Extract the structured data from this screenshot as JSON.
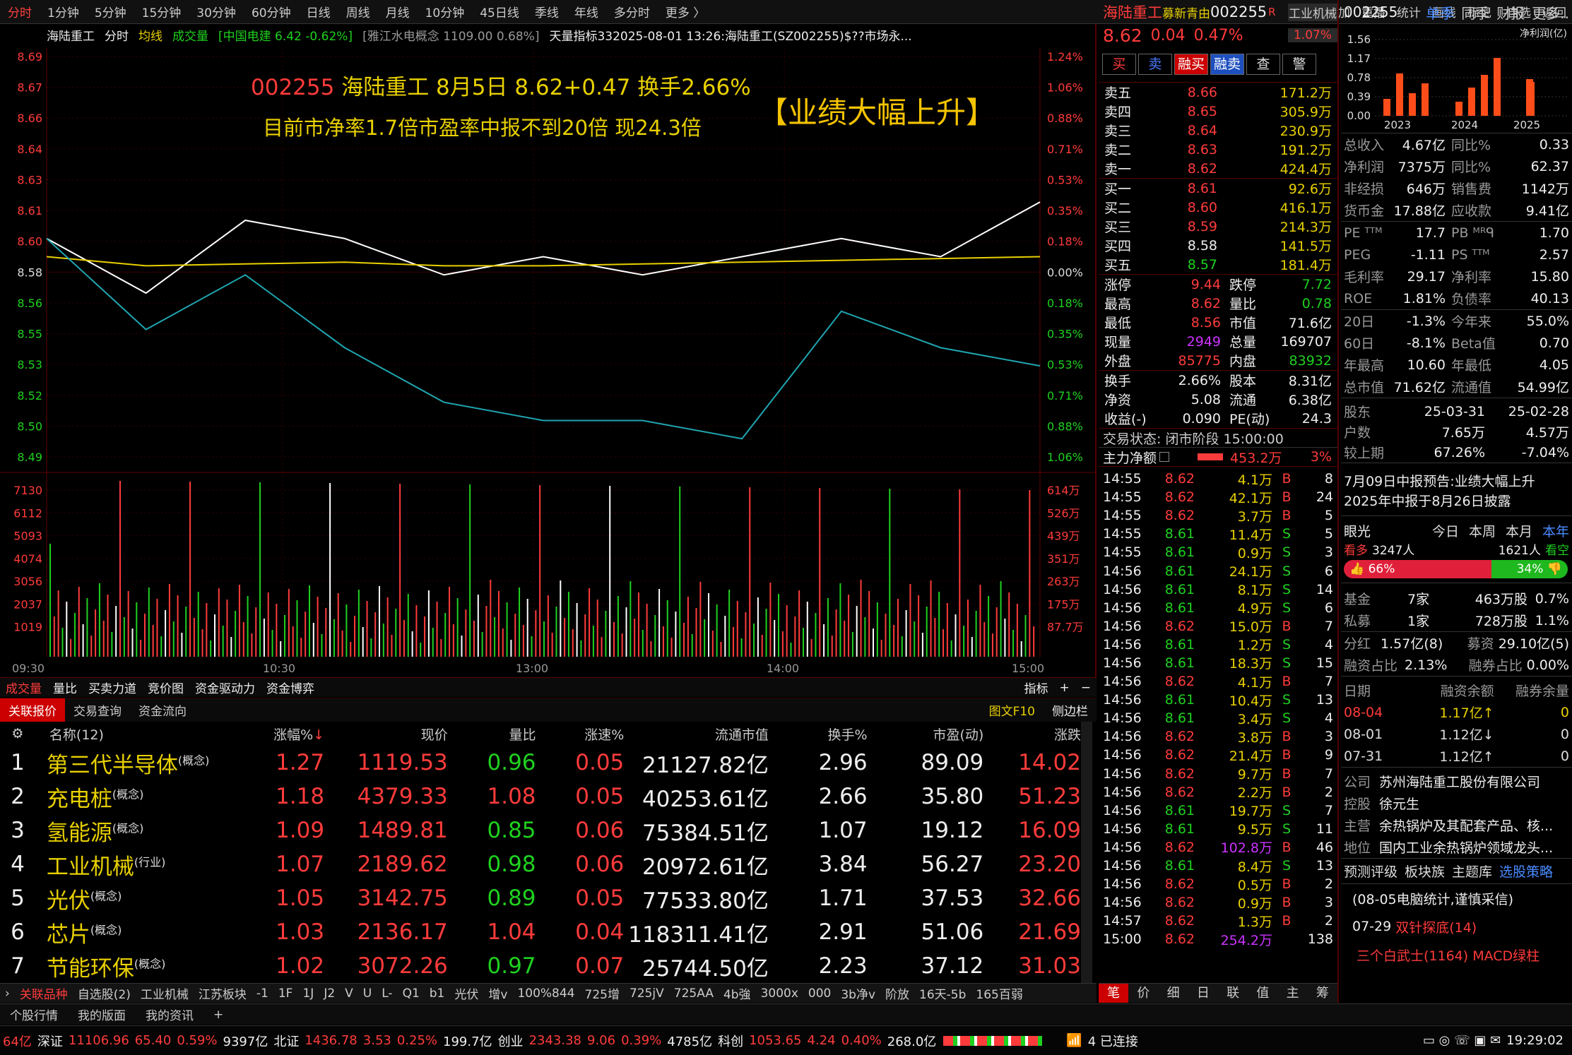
{
  "topbar": {
    "periods": [
      "分时",
      "1分钟",
      "5分钟",
      "15分钟",
      "30分钟",
      "60分钟",
      "日线",
      "周线",
      "月线",
      "10分钟",
      "45日线",
      "季线",
      "年线",
      "多分时",
      "更多 〉"
    ],
    "tools": [
      "竞价",
      "叠加",
      "重播",
      "统计",
      "画线",
      "标记",
      "-自选",
      "返回"
    ]
  },
  "chart": {
    "header": {
      "name": "海陆重工",
      "mode": "分时",
      "avg": "均线",
      "vol": "成交量",
      "ref1": "[中国电建 6.42 -0.62%]",
      "ref2": "[雅江水电概念 1109.00 0.68%]",
      "ref3": "天量指标332025-08-01 13:26:海陆重工(SZ002255)$??市场永..."
    },
    "annotation": {
      "code": "002255",
      "line1": "海陆重工 8月5日 8.62+0.47 换手2.66%",
      "line2": "目前市净率1.7倍市盈率中报不到20倍 现24.3倍",
      "badge": "【业绩大幅上升】"
    },
    "price_axis": [
      "8.69",
      "8.67",
      "8.66",
      "8.64",
      "8.63",
      "8.61",
      "8.60",
      "8.58",
      "8.56",
      "8.55",
      "8.53",
      "8.52",
      "8.50",
      "8.49"
    ],
    "pct_axis": [
      "1.24%",
      "1.06%",
      "0.88%",
      "0.71%",
      "0.53%",
      "0.35%",
      "0.18%",
      "0.00%",
      "0.18%",
      "0.35%",
      "0.53%",
      "0.71%",
      "0.88%",
      "1.06%"
    ],
    "vol_axis_left": [
      "7130",
      "6112",
      "5093",
      "4074",
      "3056",
      "2037",
      "1019"
    ],
    "vol_axis_right": [
      "614万",
      "526万",
      "439万",
      "351万",
      "263万",
      "175万",
      "87.7万"
    ],
    "time_axis": [
      "09:30",
      "10:30",
      "13:00",
      "14:00",
      "15:00"
    ],
    "colors": {
      "price_line": "#ffffff",
      "avg_line": "#e8d000",
      "ref_line": "#1fa5b0",
      "up": "#ff3b3b",
      "down": "#1fd11f"
    }
  },
  "chart_data": {
    "type": "line",
    "title": "002255 海陆重工 8月5日 8.62+0.47 换手2.66%",
    "x": [
      "09:30",
      "10:30",
      "13:00",
      "14:00",
      "15:00"
    ],
    "ylim": [
      8.48,
      8.7
    ],
    "series": [
      {
        "name": "海陆重工",
        "values": [
          8.6,
          8.57,
          8.61,
          8.6,
          8.58,
          8.59,
          8.58,
          8.59,
          8.6,
          8.59,
          8.62
        ]
      },
      {
        "name": "均线",
        "values": [
          8.59,
          8.585,
          8.586,
          8.587,
          8.585,
          8.585,
          8.586,
          8.587,
          8.588,
          8.589,
          8.59
        ]
      },
      {
        "name": "中国电建",
        "values": [
          8.6,
          8.55,
          8.58,
          8.54,
          8.51,
          8.5,
          8.5,
          8.49,
          8.56,
          8.54,
          8.53
        ]
      }
    ]
  },
  "indicator_tabs": [
    "成交量",
    "量比",
    "买卖力道",
    "竞价图",
    "资金驱动力",
    "资金博弈"
  ],
  "indicator_right": [
    "指标",
    "+",
    "−"
  ],
  "sub_tabs": [
    "关联报价",
    "交易查询",
    "资金流向"
  ],
  "sub_tabs_right": [
    "图文F10",
    "侧边栏"
  ],
  "sector_table": {
    "headers": [
      "名称(12)",
      "涨幅%",
      "现价",
      "量比",
      "涨速%",
      "流通市值",
      "换手%",
      "市盈(动)",
      "涨跌"
    ],
    "rows": [
      {
        "idx": "1",
        "name": "第三代半导体",
        "tag": "(概念)",
        "chg": "1.27",
        "price": "1119.53",
        "vr": "0.96",
        "speed": "0.05",
        "cap": "21127.82亿",
        "turn": "2.96",
        "pe": "89.09",
        "diff": "14.02"
      },
      {
        "idx": "2",
        "name": "充电桩",
        "tag": "(概念)",
        "chg": "1.18",
        "price": "4379.33",
        "vr": "1.08",
        "speed": "0.05",
        "cap": "40253.61亿",
        "turn": "2.66",
        "pe": "35.80",
        "diff": "51.23"
      },
      {
        "idx": "3",
        "name": "氢能源",
        "tag": "(概念)",
        "chg": "1.09",
        "price": "1489.81",
        "vr": "0.85",
        "speed": "0.06",
        "cap": "75384.51亿",
        "turn": "1.07",
        "pe": "19.12",
        "diff": "16.09"
      },
      {
        "idx": "4",
        "name": "工业机械",
        "tag": "(行业)",
        "chg": "1.07",
        "price": "2189.62",
        "vr": "0.98",
        "speed": "0.06",
        "cap": "20972.61亿",
        "turn": "3.84",
        "pe": "56.27",
        "diff": "23.20"
      },
      {
        "idx": "5",
        "name": "光伏",
        "tag": "(概念)",
        "chg": "1.05",
        "price": "3142.75",
        "vr": "0.89",
        "speed": "0.05",
        "cap": "77533.80亿",
        "turn": "1.71",
        "pe": "37.53",
        "diff": "32.66"
      },
      {
        "idx": "6",
        "name": "芯片",
        "tag": "(概念)",
        "chg": "1.03",
        "price": "2136.17",
        "vr": "1.04",
        "speed": "0.04",
        "cap": "118311.41亿",
        "turn": "2.91",
        "pe": "51.06",
        "diff": "21.69"
      },
      {
        "idx": "7",
        "name": "节能环保",
        "tag": "(概念)",
        "chg": "1.02",
        "price": "3072.26",
        "vr": "0.97",
        "speed": "0.07",
        "cap": "25744.50亿",
        "turn": "2.23",
        "pe": "37.12",
        "diff": "31.03"
      }
    ]
  },
  "bottom_tabs": [
    "关联品种",
    "自选股(2)",
    "工业机械",
    "江苏板块",
    "-1",
    "1F",
    "1J",
    "J2",
    "V",
    "U",
    "L-",
    "Q1",
    "b1",
    "光伏",
    "增v",
    "100%844",
    "725增",
    "725jV",
    "725AA",
    "4b強",
    "3000x",
    "000",
    "3b净v",
    "阶放",
    "16天-5b",
    "165百弱"
  ],
  "bottom_tabs2": [
    "个股行情",
    "我的版面",
    "我的资讯",
    "+"
  ],
  "status": {
    "sz_vol": "64亿",
    "sz": "深证",
    "sz_val": "11106.96",
    "sz_chg": "65.40",
    "sz_pct": "0.59%",
    "sz_amt": "9397亿",
    "bz": "北证",
    "bz_val": "1436.78",
    "bz_chg": "3.53",
    "bz_pct": "0.25%",
    "bz_amt": "199.7亿",
    "cy": "创业",
    "cy_val": "2343.38",
    "cy_chg": "9.06",
    "cy_pct": "0.39%",
    "cy_amt": "4785亿",
    "kc": "科创",
    "kc_val": "1053.65",
    "kc_chg": "4.24",
    "kc_pct": "0.40%",
    "kc_amt": "268.0亿",
    "conn": "4 已连接",
    "time": "19:29:02"
  },
  "quote": {
    "name": "海陆重工",
    "tag": "募新青由",
    "code": "002255",
    "flag": "R",
    "industry": "工业机械",
    "industry_pct": "1.07%",
    "price": "8.62",
    "change": "0.04",
    "pct": "0.47%",
    "buttons": [
      "买",
      "卖",
      "融买",
      "融卖",
      "查",
      "警"
    ],
    "asks": [
      {
        "label": "卖五",
        "price": "8.66",
        "vol": "171.2万"
      },
      {
        "label": "卖四",
        "price": "8.65",
        "vol": "305.9万"
      },
      {
        "label": "卖三",
        "price": "8.64",
        "vol": "230.9万"
      },
      {
        "label": "卖二",
        "price": "8.63",
        "vol": "191.2万"
      },
      {
        "label": "卖一",
        "price": "8.62",
        "vol": "424.4万"
      }
    ],
    "bids": [
      {
        "label": "买一",
        "price": "8.61",
        "vol": "92.6万"
      },
      {
        "label": "买二",
        "price": "8.60",
        "vol": "416.1万"
      },
      {
        "label": "买三",
        "price": "8.59",
        "vol": "214.3万"
      },
      {
        "label": "买四",
        "price": "8.58",
        "vol": "141.5万"
      },
      {
        "label": "买五",
        "price": "8.57",
        "vol": "181.4万"
      }
    ],
    "stats": [
      {
        "l1": "涨停",
        "v1": "9.44",
        "l2": "跌停",
        "v2": "7.72"
      },
      {
        "l1": "最高",
        "v1": "8.62",
        "l2": "量比",
        "v2": "0.78"
      },
      {
        "l1": "最低",
        "v1": "8.56",
        "l2": "市值",
        "v2": "71.6亿"
      },
      {
        "l1": "现量",
        "v1": "2949",
        "l2": "总量",
        "v2": "169707"
      },
      {
        "l1": "外盘",
        "v1": "85775",
        "l2": "内盘",
        "v2": "83932"
      }
    ],
    "stats2": [
      {
        "l1": "换手",
        "v1": "2.66%",
        "l2": "股本",
        "v2": "8.31亿"
      },
      {
        "l1": "净资",
        "v1": "5.08",
        "l2": "流通",
        "v2": "6.38亿"
      },
      {
        "l1": "收益(-)",
        "v1": "0.090",
        "l2": "PE(动)",
        "v2": "24.3"
      }
    ],
    "trade_state": "交易状态: 闭市阶段 15:00:00",
    "main_net_label": "主力净额",
    "main_net_val": "453.2万",
    "main_net_pct": "3%",
    "ticks": [
      {
        "t": "14:55",
        "p": "8.62",
        "v": "4.1万",
        "d": "B",
        "n": "8"
      },
      {
        "t": "14:55",
        "p": "8.62",
        "v": "42.1万",
        "d": "B",
        "n": "24"
      },
      {
        "t": "14:55",
        "p": "8.62",
        "v": "3.7万",
        "d": "B",
        "n": "5"
      },
      {
        "t": "14:55",
        "p": "8.61",
        "v": "11.4万",
        "d": "S",
        "n": "5"
      },
      {
        "t": "14:55",
        "p": "8.61",
        "v": "0.9万",
        "d": "S",
        "n": "3"
      },
      {
        "t": "14:56",
        "p": "8.61",
        "v": "24.1万",
        "d": "S",
        "n": "6"
      },
      {
        "t": "14:56",
        "p": "8.61",
        "v": "8.1万",
        "d": "S",
        "n": "14"
      },
      {
        "t": "14:56",
        "p": "8.61",
        "v": "4.9万",
        "d": "S",
        "n": "6"
      },
      {
        "t": "14:56",
        "p": "8.62",
        "v": "15.0万",
        "d": "B",
        "n": "7"
      },
      {
        "t": "14:56",
        "p": "8.61",
        "v": "1.2万",
        "d": "S",
        "n": "4"
      },
      {
        "t": "14:56",
        "p": "8.61",
        "v": "18.3万",
        "d": "S",
        "n": "15"
      },
      {
        "t": "14:56",
        "p": "8.62",
        "v": "4.1万",
        "d": "B",
        "n": "7"
      },
      {
        "t": "14:56",
        "p": "8.61",
        "v": "10.4万",
        "d": "S",
        "n": "13"
      },
      {
        "t": "14:56",
        "p": "8.61",
        "v": "3.4万",
        "d": "S",
        "n": "4"
      },
      {
        "t": "14:56",
        "p": "8.62",
        "v": "3.8万",
        "d": "B",
        "n": "3"
      },
      {
        "t": "14:56",
        "p": "8.62",
        "v": "21.4万",
        "d": "B",
        "n": "9"
      },
      {
        "t": "14:56",
        "p": "8.62",
        "v": "9.7万",
        "d": "B",
        "n": "7"
      },
      {
        "t": "14:56",
        "p": "8.62",
        "v": "2.2万",
        "d": "B",
        "n": "2"
      },
      {
        "t": "14:56",
        "p": "8.61",
        "v": "19.7万",
        "d": "S",
        "n": "7"
      },
      {
        "t": "14:56",
        "p": "8.61",
        "v": "9.5万",
        "d": "S",
        "n": "11"
      },
      {
        "t": "14:56",
        "p": "8.62",
        "v": "102.8万",
        "d": "B",
        "n": "46"
      },
      {
        "t": "14:56",
        "p": "8.61",
        "v": "8.4万",
        "d": "S",
        "n": "13"
      },
      {
        "t": "14:56",
        "p": "8.62",
        "v": "0.5万",
        "d": "B",
        "n": "2"
      },
      {
        "t": "14:56",
        "p": "8.62",
        "v": "0.9万",
        "d": "B",
        "n": "3"
      },
      {
        "t": "14:57",
        "p": "8.62",
        "v": "1.3万",
        "d": "B",
        "n": "2"
      },
      {
        "t": "15:00",
        "p": "8.62",
        "v": "254.2万",
        "d": "",
        "n": "138"
      }
    ],
    "bottom_tabs": [
      "笔",
      "价",
      "细",
      "日",
      "联",
      "值",
      "主",
      "筹"
    ]
  },
  "fund": {
    "code": "002255",
    "tabs": [
      "单季",
      "同季",
      "财报",
      "更多.."
    ],
    "chart_legend": "净利润(亿)",
    "chart_y": [
      "1.56",
      "1.17",
      "0.78",
      "0.39",
      "0.00"
    ],
    "chart_x": [
      "2023",
      "2024",
      "2025"
    ],
    "rows1": [
      {
        "l1": "总收入",
        "v1": "4.67亿",
        "l2": "同比%",
        "v2": "0.33"
      },
      {
        "l1": "净利润",
        "v1": "7375万",
        "l2": "同比%",
        "v2": "62.37"
      },
      {
        "l1": "非经损",
        "v1": "646万",
        "l2": "销售费",
        "v2": "1142万"
      },
      {
        "l1": "货币金",
        "v1": "17.88亿",
        "l2": "应收款",
        "v2": "9.41亿"
      }
    ],
    "rows2": [
      {
        "l1": "PE ᵀᵀᴹ",
        "v1": "17.7",
        "l2": "PB ᴹᴿᑫ",
        "v2": "1.70"
      },
      {
        "l1": "PEG",
        "v1": "-1.11",
        "l2": "PS ᵀᵀᴹ",
        "v2": "2.57"
      },
      {
        "l1": "毛利率",
        "v1": "29.17",
        "l2": "净利率",
        "v2": "15.80"
      },
      {
        "l1": "ROE",
        "v1": "1.81%",
        "l2": "负债率",
        "v2": "40.13"
      }
    ],
    "rows3": [
      {
        "l1": "20日",
        "v1": "-1.3%",
        "l2": "今年来",
        "v2": "55.0%"
      },
      {
        "l1": "60日",
        "v1": "-8.1%",
        "l2": "Beta值",
        "v2": "0.70"
      },
      {
        "l1": "年最高",
        "v1": "10.60",
        "l2": "年最低",
        "v2": "4.05"
      },
      {
        "l1": "总市值",
        "v1": "71.62亿",
        "l2": "流通值",
        "v2": "54.99亿"
      }
    ],
    "holders": [
      {
        "l": "股东",
        "a": "25-03-31",
        "b": "25-02-28"
      },
      {
        "l": "户数",
        "a": "7.65万",
        "b": "4.57万"
      },
      {
        "l": "较上期",
        "a": "67.26%",
        "b": "-7.04%"
      }
    ],
    "notice1": "7月09日中报预告:业绩大幅上升",
    "notice2": "2025年中报于8月26日披露",
    "eye_label": "眼光",
    "eye_tabs": [
      "今日",
      "本周",
      "本月",
      "本年"
    ],
    "bull_label": "看多",
    "bull_count": "3247人",
    "bear_count": "1621人",
    "bear_label": "看空",
    "bull_pct": "66%",
    "bear_pct": "34%",
    "inst": [
      {
        "l": "基金",
        "a": "7家",
        "b": "463万股",
        "c": "0.7%"
      },
      {
        "l": "私募",
        "a": "1家",
        "b": "728万股",
        "c": "1.1%"
      }
    ],
    "fin1": {
      "l": "分红",
      "v": "1.57亿(8)",
      "l2": "募资",
      "v2": "29.10亿(5)"
    },
    "fin2": {
      "l": "融资占比",
      "v": "2.13%",
      "l2": "融券占比",
      "v2": "0.00%"
    },
    "margin_head": [
      "日期",
      "融资余额",
      "融券余量"
    ],
    "margin_rows": [
      {
        "d": "08-04",
        "a": "1.17亿↑",
        "b": "0"
      },
      {
        "d": "08-01",
        "a": "1.12亿↓",
        "b": "0"
      },
      {
        "d": "07-31",
        "a": "1.12亿↑",
        "b": "0"
      }
    ],
    "company": [
      {
        "l": "公司",
        "v": "苏州海陆重工股份有限公司"
      },
      {
        "l": "控股",
        "v": "徐元生"
      },
      {
        "l": "主营",
        "v": "余热锅炉及其配套产品、核..."
      },
      {
        "l": "地位",
        "v": "国内工业余热锅炉领域龙头..."
      }
    ],
    "links": [
      "预测评级",
      "板块族",
      "主题库",
      "选股策略"
    ],
    "news": [
      {
        "date": "(08-05电脑统计,谨慎采信)",
        "title": ""
      },
      {
        "date": "07-29",
        "title": "双针探底(14)"
      },
      {
        "date": "",
        "title": "三个白武士(1164) MACD绿柱"
      }
    ]
  }
}
